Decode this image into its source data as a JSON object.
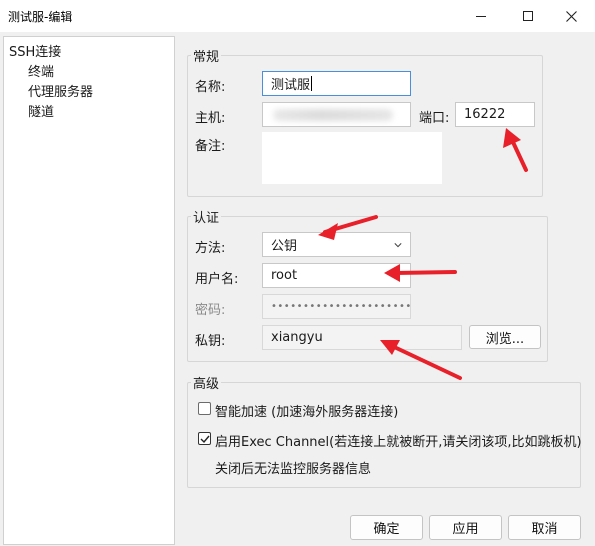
{
  "window": {
    "title": "测试服-编辑"
  },
  "tree": {
    "root": "SSH连接",
    "children": [
      "终端",
      "代理服务器",
      "隧道"
    ]
  },
  "general": {
    "title": "常规",
    "name_label": "名称:",
    "name_value": "测试服",
    "host_label": "主机:",
    "port_label": "端口:",
    "port_value": "16222",
    "note_label": "备注:"
  },
  "auth": {
    "title": "认证",
    "method_label": "方法:",
    "method_value": "公钥",
    "user_label": "用户名:",
    "user_value": "root",
    "password_label": "密码:",
    "password_value": "••••••••••••••••••••••••",
    "key_label": "私钥:",
    "key_value": "xiangyu",
    "browse_label": "浏览..."
  },
  "advanced": {
    "title": "高级",
    "smart_accel_label": "智能加速 (加速海外服务器连接)",
    "smart_accel_checked": false,
    "exec_channel_label": "启用Exec Channel(若连接上就被断开,请关闭该项,比如跳板机)",
    "exec_channel_checked": true,
    "exec_channel_note": "关闭后无法监控服务器信息"
  },
  "footer": {
    "ok_label": "确定",
    "apply_label": "应用",
    "cancel_label": "取消"
  },
  "colors": {
    "accent": "#4a8fd9",
    "arrow": "#e8202a"
  }
}
